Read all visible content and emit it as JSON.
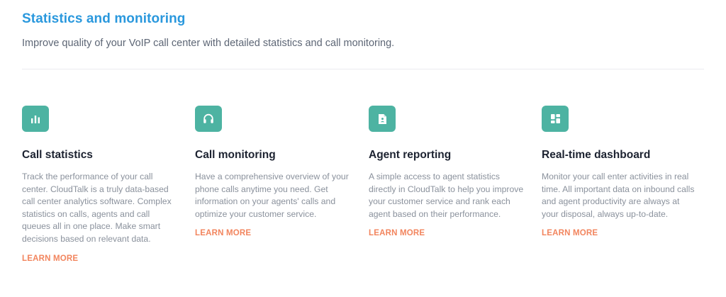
{
  "header": {
    "title": "Statistics and monitoring",
    "subtitle": "Improve quality of your VoIP call center with detailed statistics and call monitoring."
  },
  "colors": {
    "title_accent": "#2a98dd",
    "icon_background": "#4db3a2",
    "link_accent": "#f2855e"
  },
  "features": [
    {
      "icon": "bar-chart-icon",
      "title": "Call statistics",
      "description": "Track the performance of your call center. CloudTalk is a truly data-based call center analytics software. Complex statistics on calls, agents and call queues all in one place. Make smart decisions based on relevant data.",
      "link": "LEARN MORE"
    },
    {
      "icon": "headphones-icon",
      "title": "Call monitoring",
      "description": "Have a comprehensive overview of your phone calls anytime you need. Get information on your agents' calls and optimize your customer service.",
      "link": "LEARN MORE"
    },
    {
      "icon": "user-report-icon",
      "title": "Agent reporting",
      "description": "A simple access to agent statistics directly in CloudTalk to help you improve your customer service and rank each agent based on their performance.",
      "link": "LEARN MORE"
    },
    {
      "icon": "dashboard-icon",
      "title": "Real-time dashboard",
      "description": "Monitor your call enter activities in real time. All important data on inbound calls and agent productivity are always at your disposal, always up-to-date.",
      "link": "LEARN MORE"
    }
  ]
}
